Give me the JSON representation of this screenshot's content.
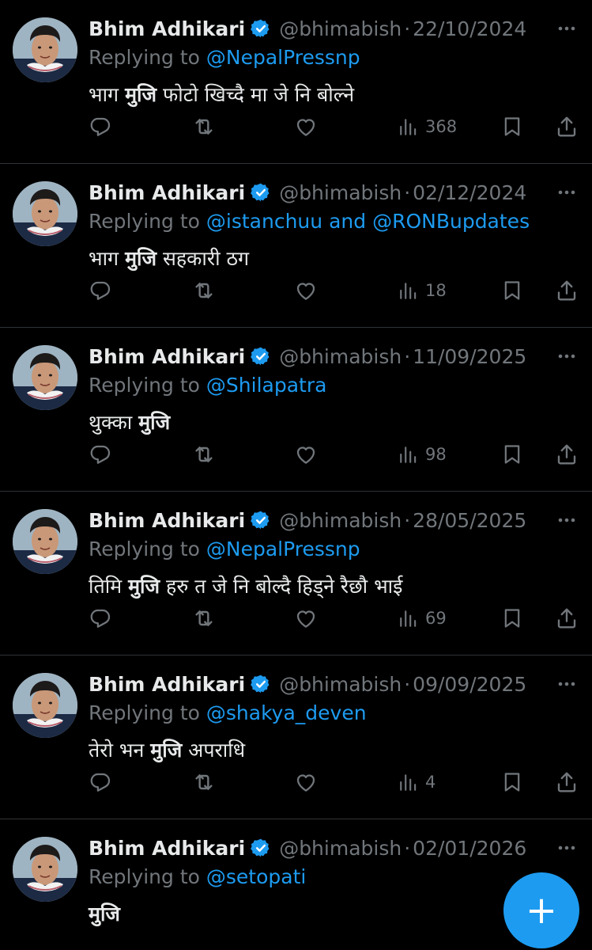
{
  "tweets": [
    {
      "name": "Bhim Adhikari",
      "handle": "@bhimabish",
      "dot": "·",
      "date": "22/10/2024",
      "replying_label": "Replying to",
      "mentions": [
        "@NepalPressnp"
      ],
      "conj": "",
      "text_pre": "भाग ",
      "text_bold": "मुजि",
      "text_post": " फोटो खिच्दै मा जे नि बोल्ने",
      "views": "368"
    },
    {
      "name": "Bhim Adhikari",
      "handle": "@bhimabish",
      "dot": "·",
      "date": "02/12/2024",
      "replying_label": "Replying to",
      "mentions": [
        "@istanchuu",
        "@RONBupdates"
      ],
      "conj": "and",
      "text_pre": "भाग ",
      "text_bold": "मुजि",
      "text_post": " सहकारी ठग",
      "views": "18"
    },
    {
      "name": "Bhim Adhikari",
      "handle": "@bhimabish",
      "dot": "·",
      "date": "11/09/2025",
      "replying_label": "Replying to",
      "mentions": [
        "@Shilapatra"
      ],
      "conj": "",
      "text_pre": "थुक्का ",
      "text_bold": "मुजि",
      "text_post": "",
      "views": "98"
    },
    {
      "name": "Bhim Adhikari",
      "handle": "@bhimabish",
      "dot": "·",
      "date": "28/05/2025",
      "replying_label": "Replying to",
      "mentions": [
        "@NepalPressnp"
      ],
      "conj": "",
      "text_pre": "तिमि ",
      "text_bold": "मुजि",
      "text_post": " हरु त जे नि बोल्दै हिड्ने रैछौ भाई",
      "views": "69"
    },
    {
      "name": "Bhim Adhikari",
      "handle": "@bhimabish",
      "dot": "·",
      "date": "09/09/2025",
      "replying_label": "Replying to",
      "mentions": [
        "@shakya_deven"
      ],
      "conj": "",
      "text_pre": "तेरो भन ",
      "text_bold": "मुजि",
      "text_post": " अपराधि",
      "views": "4"
    },
    {
      "name": "Bhim Adhikari",
      "handle": "@bhimabish",
      "dot": "·",
      "date": "02/01/2026",
      "replying_label": "Replying to",
      "mentions": [
        "@setopati"
      ],
      "conj": "",
      "text_pre": "",
      "text_bold": "मुजि",
      "text_post": "",
      "views": ""
    }
  ],
  "compose_button": "+",
  "colors": {
    "background": "#000000",
    "text": "#e7e9ea",
    "muted": "#71767b",
    "accent": "#1d9bf0",
    "divider": "#2f3336"
  },
  "icons": {
    "verified": "verified-badge-icon",
    "more": "more-options-icon",
    "reply": "reply-icon",
    "retweet": "retweet-icon",
    "like": "heart-icon",
    "views": "views-chart-icon",
    "bookmark": "bookmark-icon",
    "share": "share-icon",
    "compose": "plus-icon"
  }
}
